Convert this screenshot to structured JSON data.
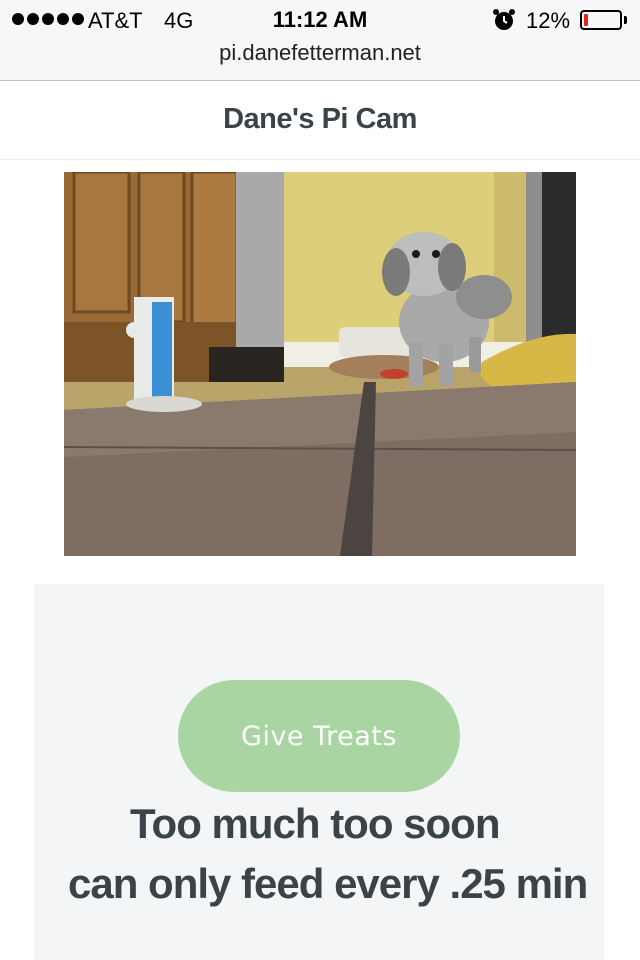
{
  "status_bar": {
    "carrier": "AT&T",
    "network": "4G",
    "time": "11:12 AM",
    "battery": "12%",
    "battery_level": 0.12,
    "signal_bars": 5,
    "icons": [
      "signal-dots-icon",
      "alarm-clock-icon",
      "battery-icon"
    ]
  },
  "browser": {
    "url": "pi.danefetterman.net"
  },
  "header": {
    "title": "Dane's Pi Cam"
  },
  "camera": {
    "image": "live-camera-feed"
  },
  "controls": {
    "button_label": "Give Treats",
    "button_color": "#a9d5a2",
    "message_line1": "Too much too soon",
    "message_line2": "can only feed every .25 min"
  },
  "colors": {
    "text": "#3a4448",
    "panel": "#f4f5f7",
    "battery_low": "#e0241b"
  }
}
